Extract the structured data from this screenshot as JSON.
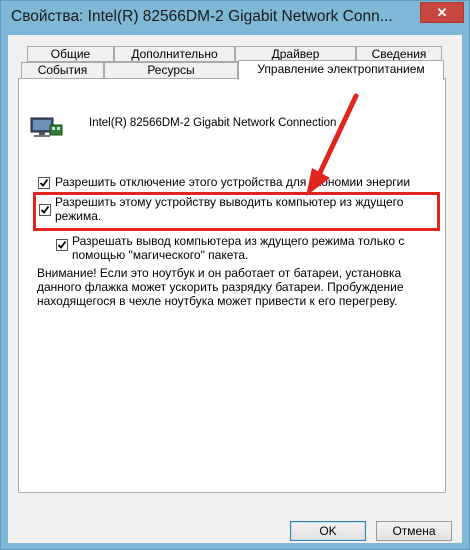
{
  "window": {
    "title": "Свойства: Intel(R) 82566DM-2 Gigabit Network Conn...",
    "close_glyph": "✕",
    "accent": "#7fb7d6",
    "close_color": "#c7463d"
  },
  "tabs": {
    "row1": [
      "Общие",
      "Дополнительно",
      "Драйвер",
      "Сведения"
    ],
    "row2": [
      "События",
      "Ресурсы",
      "Управление электропитанием"
    ],
    "active": "Управление электропитанием"
  },
  "device": {
    "icon": "network-adapter-icon",
    "name": "Intel(R) 82566DM-2 Gigabit Network Connection"
  },
  "options": [
    {
      "label": "Разрешить отключение этого устройства для экономии энергии",
      "checked": true
    },
    {
      "label_line1": "Разрешить этому устройству выводить компьютер из ждущего",
      "label_line2": "режима.",
      "checked": true
    },
    {
      "label_line1": "Разрешать вывод компьютера из ждущего режима только с",
      "label_line2": "помощью \"магического\" пакета.",
      "checked": true
    }
  ],
  "warning": {
    "line1": "Внимание! Если это ноутбук и он работает от батареи, установка",
    "line2": "данного флажка может ускорить разрядку батареи. Пробуждение",
    "line3": "находящегося в чехле ноутбука может привести к его перегреву."
  },
  "annotation": {
    "color": "#e1241e"
  },
  "buttons": {
    "ok": "OK",
    "cancel": "Отмена"
  }
}
